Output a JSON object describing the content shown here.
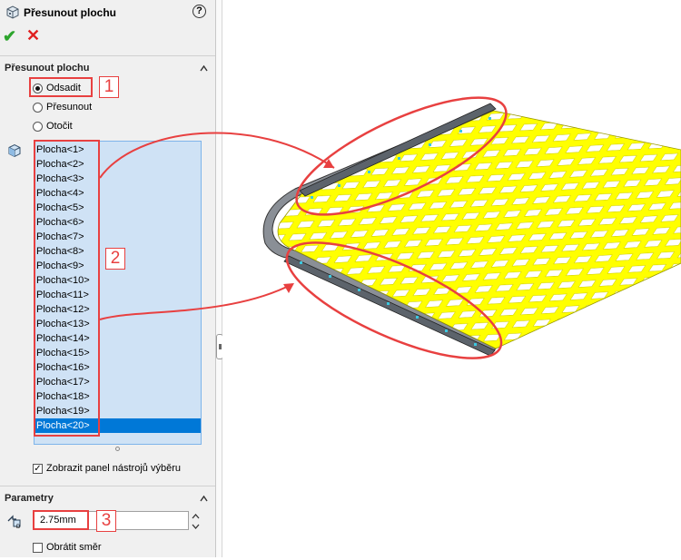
{
  "header": {
    "title": "Přesunout plochu",
    "help_glyph": "?"
  },
  "actions": {
    "ok_glyph": "✔",
    "cancel_glyph": "✕"
  },
  "move_section": {
    "title": "Přesunout plochu",
    "options": [
      {
        "label": "Odsadit",
        "selected": true
      },
      {
        "label": "Přesunout",
        "selected": false
      },
      {
        "label": "Otočit",
        "selected": false
      }
    ],
    "faces": [
      "Plocha<1>",
      "Plocha<2>",
      "Plocha<3>",
      "Plocha<4>",
      "Plocha<5>",
      "Plocha<6>",
      "Plocha<7>",
      "Plocha<8>",
      "Plocha<9>",
      "Plocha<10>",
      "Plocha<11>",
      "Plocha<12>",
      "Plocha<13>",
      "Plocha<14>",
      "Plocha<15>",
      "Plocha<16>",
      "Plocha<17>",
      "Plocha<18>",
      "Plocha<19>",
      "Plocha<20>"
    ],
    "selected_face": "Plocha<20>",
    "show_toolbar_label": "Zobrazit panel nástrojů výběru",
    "show_toolbar_checked": true
  },
  "params_section": {
    "title": "Parametry",
    "distance_value": "2.75mm",
    "reverse_label": "Obrátit směr",
    "reverse_checked": false
  },
  "callouts": {
    "one": "1",
    "two": "2",
    "three": "3"
  },
  "colors": {
    "accent": "#e84040",
    "selection": "#0078d7",
    "list_bg": "#cfe2f5",
    "mesh": "#ffff00"
  }
}
